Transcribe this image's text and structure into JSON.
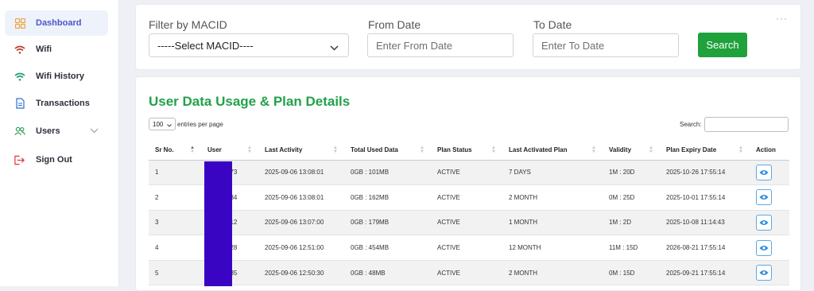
{
  "sidebar": {
    "items": [
      {
        "label": "Dashboard",
        "icon": "dashboard-icon",
        "active": true
      },
      {
        "label": "Wifi",
        "icon": "wifi-icon"
      },
      {
        "label": "Wifi History",
        "icon": "wifi-icon"
      },
      {
        "label": "Transactions",
        "icon": "document-icon"
      },
      {
        "label": "Users",
        "icon": "users-icon"
      },
      {
        "label": "Sign Out",
        "icon": "sign-out-icon"
      }
    ]
  },
  "filter": {
    "macid_label": "Filter by MACID",
    "macid_value": "-----Select MACID----",
    "from_label": "From Date",
    "from_placeholder": "Enter From Date",
    "to_label": "To Date",
    "to_placeholder": "Enter To Date",
    "search_button": "Search",
    "more": "···"
  },
  "table_card": {
    "title": "User Data Usage & Plan Details",
    "page_length": "100",
    "page_length_text": "entries per page",
    "search_label": "Search:",
    "columns": [
      "Sr No.",
      "User",
      "Last Activity",
      "Total Used Data",
      "Plan Status",
      "Last Activated Plan",
      "Validity",
      "Plan Expiry Date",
      "Action"
    ],
    "rows": [
      {
        "sr": "1",
        "user": "773",
        "last_activity": "2025-09-06 13:08:01",
        "used": "0GB : 101MB",
        "status": "ACTIVE",
        "plan": "7 DAYS",
        "validity": "1M : 20D",
        "expiry": "2025-10-26 17:55:14"
      },
      {
        "sr": "2",
        "user": "784",
        "last_activity": "2025-09-06 13:08:01",
        "used": "0GB : 162MB",
        "status": "ACTIVE",
        "plan": "2 MONTH",
        "validity": "0M : 25D",
        "expiry": "2025-10-01 17:55:14"
      },
      {
        "sr": "3",
        "user": "212",
        "last_activity": "2025-09-06 13:07:00",
        "used": "0GB : 179MB",
        "status": "ACTIVE",
        "plan": "1 MONTH",
        "validity": "1M : 2D",
        "expiry": "2025-10-08 11:14:43"
      },
      {
        "sr": "4",
        "user": "028",
        "last_activity": "2025-09-06 12:51:00",
        "used": "0GB : 454MB",
        "status": "ACTIVE",
        "plan": "12 MONTH",
        "validity": "11M : 15D",
        "expiry": "2026-08-21 17:55:14"
      },
      {
        "sr": "5",
        "user": "335",
        "last_activity": "2025-09-06 12:50:30",
        "used": "0GB : 48MB",
        "status": "ACTIVE",
        "plan": "2 MONTH",
        "validity": "0M : 15D",
        "expiry": "2025-09-21 17:55:14"
      }
    ]
  },
  "colors": {
    "accent": "#4a58c7",
    "title_green": "#22a14a",
    "button_green": "#1fa13c",
    "redaction": "#3a05c2",
    "action_blue": "#2f8fdc"
  }
}
